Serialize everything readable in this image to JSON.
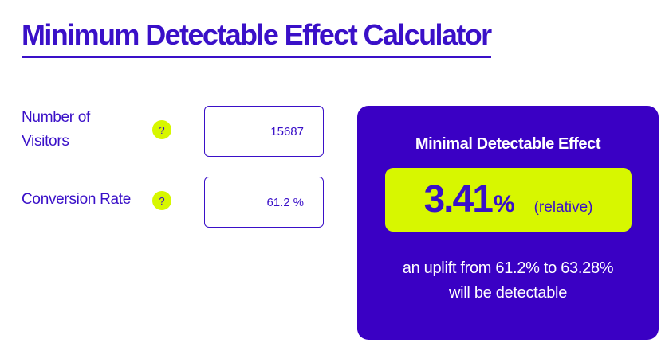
{
  "page": {
    "title": "Minimum Detectable Effect Calculator"
  },
  "form": {
    "visitors": {
      "label_line1": "Number of",
      "label_line2": "Visitors",
      "help_icon": "?",
      "value": "15687"
    },
    "conversion_rate": {
      "label": "Conversion Rate",
      "help_icon": "?",
      "value": "61.2",
      "unit": "%"
    }
  },
  "result": {
    "heading": "Minimal Detectable Effect",
    "value": "3.41",
    "unit": "%",
    "note": "(relative)",
    "description_line1": "an uplift from 61.2% to 63.28%",
    "description_line2": "will be detectable"
  },
  "colors": {
    "brand": "#3a10c8",
    "panel": "#3a00c4",
    "accent": "#d7f700"
  }
}
